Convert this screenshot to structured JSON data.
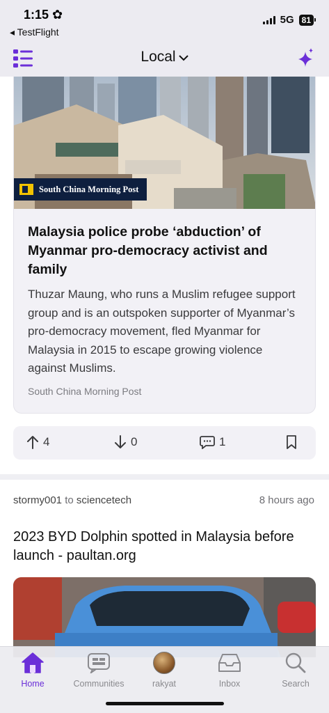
{
  "status": {
    "time": "1:15",
    "back_app": "◂ TestFlight",
    "network": "5G",
    "battery": "81"
  },
  "header": {
    "title": "Local",
    "menu_icon": "list-icon",
    "ai_icon": "sparkle-icon"
  },
  "article": {
    "source_badge": "South China Morning Post",
    "title": "Malaysia police probe ‘abduction’ of Myanmar pro-democracy activist and family",
    "description": "Thuzar Maung, who runs a Muslim refugee support group and is an outspoken supporter of Myanmar’s pro-democracy movement, fled Myanmar for Malaysia in 2015 to escape growing violence against Muslims.",
    "source": "South China Morning Post"
  },
  "actions": {
    "upvotes": "4",
    "downvotes": "0",
    "comments": "1"
  },
  "post": {
    "user": "stormy001",
    "to": "to",
    "community": "sciencetech",
    "time": "8 hours ago",
    "title": "2023 BYD Dolphin spotted in Malaysia before launch - paultan.org"
  },
  "tabs": [
    {
      "label": "Home",
      "icon": "home-icon",
      "active": true
    },
    {
      "label": "Communities",
      "icon": "communities-icon"
    },
    {
      "label": "rakyat",
      "icon": "avatar"
    },
    {
      "label": "Inbox",
      "icon": "inbox-icon"
    },
    {
      "label": "Search",
      "icon": "search-icon"
    }
  ],
  "colors": {
    "accent": "#6b2fd8",
    "card_bg": "#f2f1f6",
    "badge_bg": "#0e1f3f"
  }
}
